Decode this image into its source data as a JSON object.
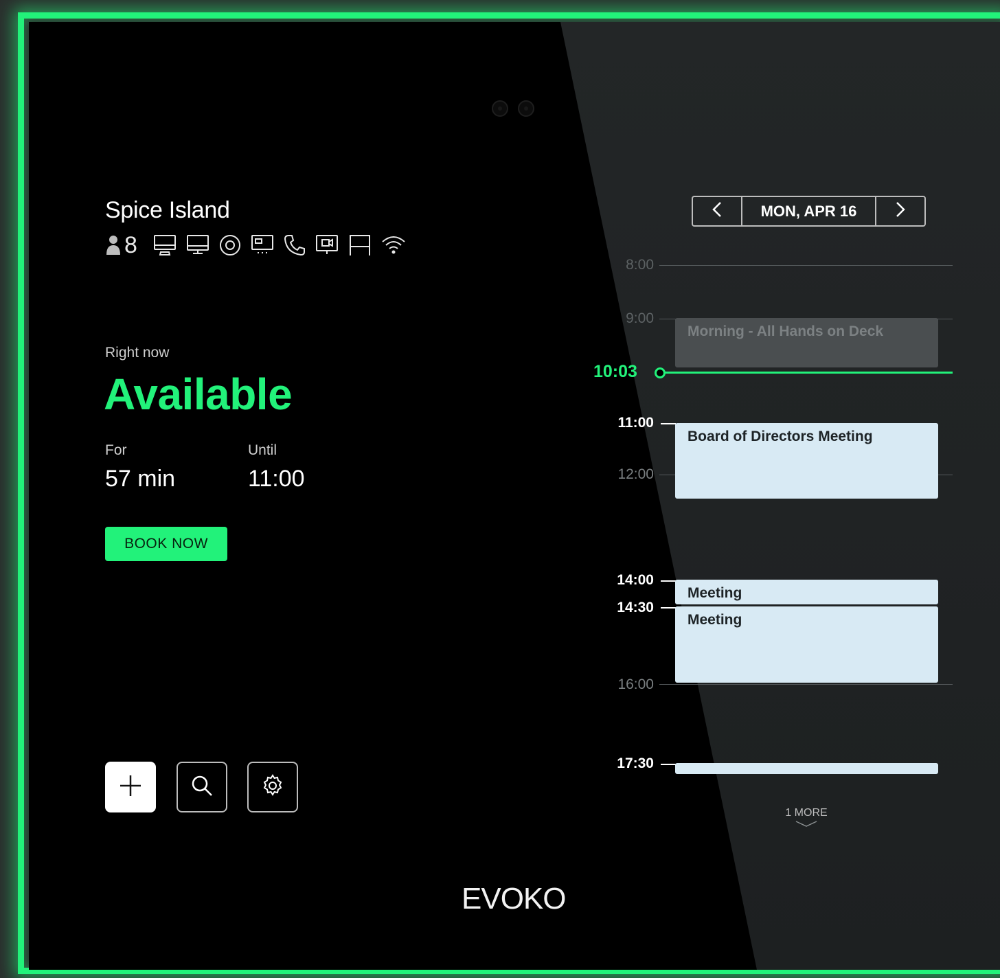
{
  "room": {
    "name": "Spice Island",
    "capacity": "8",
    "amenities": [
      "person-icon",
      "computer-icon",
      "monitor-icon",
      "speaker-icon",
      "projector-icon",
      "phone-icon",
      "video-conference-icon",
      "whiteboard-icon",
      "wifi-icon"
    ]
  },
  "status": {
    "right_now_label": "Right now",
    "state": "Available",
    "for_label": "For",
    "for_value": "57 min",
    "until_label": "Until",
    "until_value": "11:00",
    "book_label": "BOOK NOW"
  },
  "toolbar": {
    "add_icon": "plus-icon",
    "search_icon": "search-icon",
    "settings_icon": "gear-icon"
  },
  "brand": {
    "logo": "EVOKO"
  },
  "calendar": {
    "date": "MON, APR 16",
    "current_time": "10:03",
    "hours": [
      "8:00",
      "9:00",
      "11:00",
      "12:00",
      "14:00",
      "14:30",
      "16:00",
      "17:30"
    ],
    "events": [
      {
        "title": "Morning - All Hands on Deck",
        "state": "past"
      },
      {
        "title": "Board of Directors Meeting",
        "state": "upcoming"
      },
      {
        "title": "Meeting",
        "state": "upcoming"
      },
      {
        "title": "Meeting",
        "state": "upcoming"
      },
      {
        "title": "",
        "state": "upcoming"
      }
    ],
    "more_label": "1 MORE"
  },
  "colors": {
    "accent": "#22f27a",
    "event_bg": "#d8eaf4",
    "event_past_bg": "#4a4e50",
    "screen_bg": "#000000"
  }
}
